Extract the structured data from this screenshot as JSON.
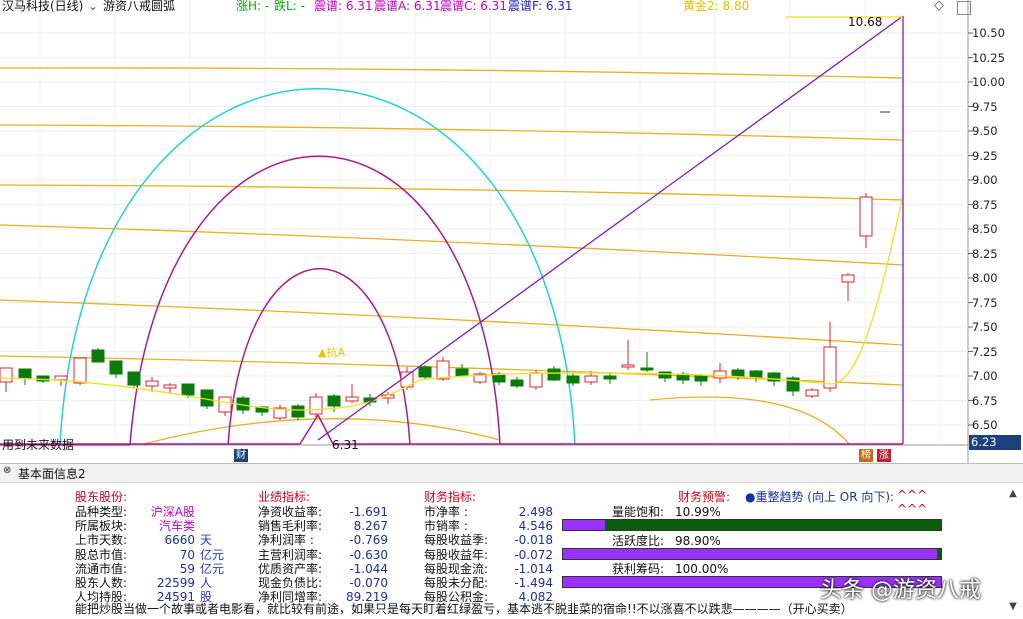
{
  "header": {
    "stock_title": "汉马科技(日线)",
    "indicator_name": "游资八戒圆弧",
    "indicators": [
      {
        "text": "涨H: -",
        "color": "#00b000"
      },
      {
        "text": "跌L: -",
        "color": "#00b000"
      },
      {
        "text": "震谱: 6.31",
        "color": "#c000c0"
      },
      {
        "text": "震谱A: 6.31",
        "color": "#c000c0"
      },
      {
        "text": "震谱C: 6.31",
        "color": "#c000c0"
      },
      {
        "text": "震谱F: 6.31",
        "color": "#2020c0"
      }
    ],
    "gold_text": "黄金2: 8.80"
  },
  "chart": {
    "price_axis": [
      "10.50",
      "10.25",
      "10.00",
      "9.75",
      "9.50",
      "9.25",
      "9.00",
      "8.75",
      "8.50",
      "8.25",
      "8.00",
      "7.75",
      "7.50",
      "7.25",
      "7.00",
      "6.75",
      "6.50"
    ],
    "current_price_tag": "6.23",
    "peak_label": "10.68",
    "low_label": "6.31",
    "dot_label": "▲抗A",
    "future_data_label": "用到未来数据",
    "marker_cai": "财",
    "marker_bang": "榜",
    "marker_zhang": "涨"
  },
  "info_panel": {
    "title": "基本面信息2",
    "shareholder": {
      "heading": "股东股份:",
      "rows": [
        {
          "label": "品种类型:",
          "value": "沪深A股",
          "unit": ""
        },
        {
          "label": "所属板块:",
          "value": "汽车类",
          "unit": ""
        },
        {
          "label": "上市天数:",
          "value": "6660",
          "unit": "天"
        },
        {
          "label": "股总市值:",
          "value": "70",
          "unit": "亿元"
        },
        {
          "label": "流通市值:",
          "value": "59",
          "unit": "亿元"
        },
        {
          "label": "股东人数:",
          "value": "22599",
          "unit": "人"
        },
        {
          "label": "人均持股:",
          "value": "24591",
          "unit": "股"
        }
      ]
    },
    "performance": {
      "heading": "业绩指标:",
      "rows": [
        {
          "label": "净资收益率:",
          "value": "-1.691"
        },
        {
          "label": "销售毛利率:",
          "value": "8.267"
        },
        {
          "label": "净利润率 :",
          "value": "-0.769"
        },
        {
          "label": "主营利润率:",
          "value": "-0.630"
        },
        {
          "label": "优质资产率:",
          "value": "-1.044"
        },
        {
          "label": "现金负债比:",
          "value": "-0.070"
        },
        {
          "label": "净利同增率:",
          "value": "89.219"
        }
      ]
    },
    "finance": {
      "heading": "财务指标:",
      "rows": [
        {
          "label": "市净率  :",
          "value": "2.498"
        },
        {
          "label": "市销率  :",
          "value": "4.546"
        },
        {
          "label": "每股收益季:",
          "value": "-0.018"
        },
        {
          "label": "每股收益年:",
          "value": "-0.072"
        },
        {
          "label": "每股现金流:",
          "value": "-1.014"
        },
        {
          "label": "每股未分配:",
          "value": "-1.494"
        },
        {
          "label": "每股公积金:",
          "value": "4.082"
        }
      ]
    },
    "warning": {
      "heading": "财务预警:",
      "dot_text": "●重整趋势 (向上 OR 向下):",
      "arrows": "^^^",
      "arrows2": "^^^",
      "bars": [
        {
          "label": "量能饱和:",
          "value_text": "10.99%",
          "fraction": 0.1099
        },
        {
          "label": "活跃度比:",
          "value_text": "98.90%",
          "fraction": 0.989
        },
        {
          "label": "获利筹码:",
          "value_text": "100.00%",
          "fraction": 1.0
        }
      ]
    },
    "footer": "能把炒股当做一个故事或者电影看，就比较有前途，如果只是每天盯着红绿盈亏，基本逃不脱韭菜的宿命!!不以涨喜不以跌悲————（开心买卖）",
    "watermark": "头条 @游资八戒"
  },
  "colors": {
    "up": "#e0202f",
    "down": "#0a7a0a",
    "arc_cyan": "#20d0e0",
    "arc_magenta": "#b0188a",
    "band_gold": "#e8b020",
    "line_purple": "#7a1fb8",
    "curve_yellow": "#f0e020"
  }
}
